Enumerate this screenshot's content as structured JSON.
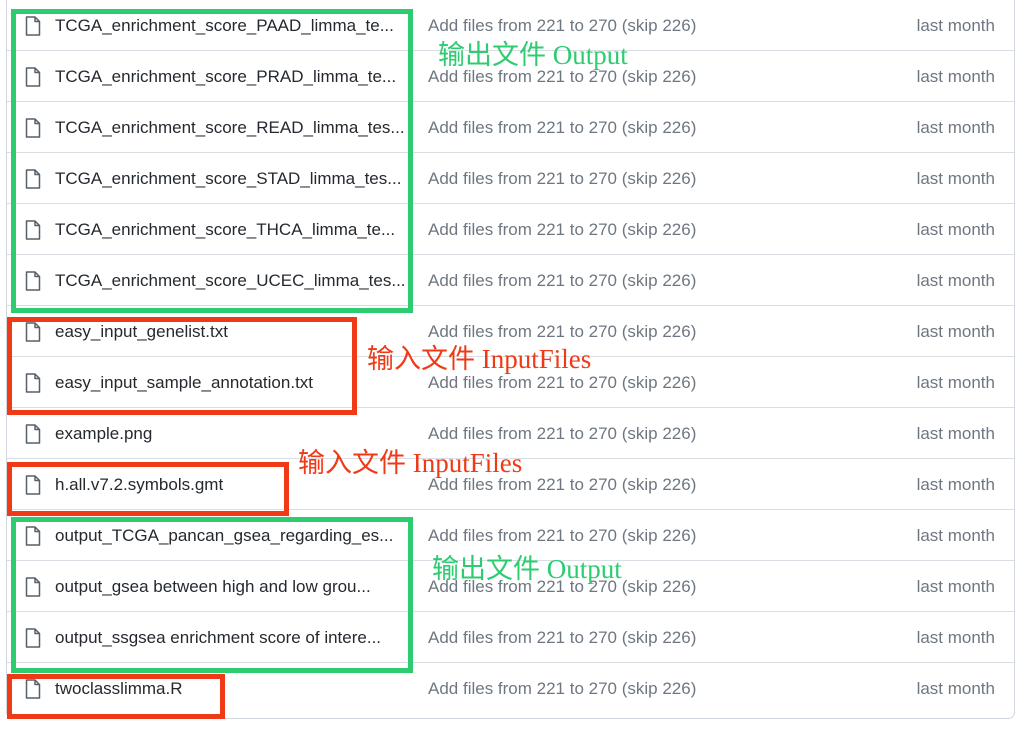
{
  "files": [
    {
      "name": "TCGA_enrichment_score_PAAD_limma_te...",
      "commit": "Add files from 221 to 270 (skip 226)",
      "age": "last month"
    },
    {
      "name": "TCGA_enrichment_score_PRAD_limma_te...",
      "commit": "Add files from 221 to 270 (skip 226)",
      "age": "last month"
    },
    {
      "name": "TCGA_enrichment_score_READ_limma_tes...",
      "commit": "Add files from 221 to 270 (skip 226)",
      "age": "last month"
    },
    {
      "name": "TCGA_enrichment_score_STAD_limma_tes...",
      "commit": "Add files from 221 to 270 (skip 226)",
      "age": "last month"
    },
    {
      "name": "TCGA_enrichment_score_THCA_limma_te...",
      "commit": "Add files from 221 to 270 (skip 226)",
      "age": "last month"
    },
    {
      "name": "TCGA_enrichment_score_UCEC_limma_tes...",
      "commit": "Add files from 221 to 270 (skip 226)",
      "age": "last month"
    },
    {
      "name": "easy_input_genelist.txt",
      "commit": "Add files from 221 to 270 (skip 226)",
      "age": "last month"
    },
    {
      "name": "easy_input_sample_annotation.txt",
      "commit": "Add files from 221 to 270 (skip 226)",
      "age": "last month"
    },
    {
      "name": "example.png",
      "commit": "Add files from 221 to 270 (skip 226)",
      "age": "last month"
    },
    {
      "name": "h.all.v7.2.symbols.gmt",
      "commit": "Add files from 221 to 270 (skip 226)",
      "age": "last month"
    },
    {
      "name": "output_TCGA_pancan_gsea_regarding_es...",
      "commit": "Add files from 221 to 270 (skip 226)",
      "age": "last month"
    },
    {
      "name": "output_gsea between high and low grou...",
      "commit": "Add files from 221 to 270 (skip 226)",
      "age": "last month"
    },
    {
      "name": "output_ssgsea enrichment score of intere...",
      "commit": "Add files from 221 to 270 (skip 226)",
      "age": "last month"
    },
    {
      "name": "twoclasslimma.R",
      "commit": "Add files from 221 to 270 (skip 226)",
      "age": "last month"
    }
  ],
  "annotations": {
    "output_label_1": "输出文件 Output",
    "input_label_1": "输入文件 InputFiles",
    "input_label_2": "输入文件 InputFiles",
    "output_label_2": "输出文件 Output"
  },
  "icons": {
    "file": "file-icon"
  },
  "colors": {
    "output_highlight": "#2ecc71",
    "input_highlight": "#f03a17"
  }
}
